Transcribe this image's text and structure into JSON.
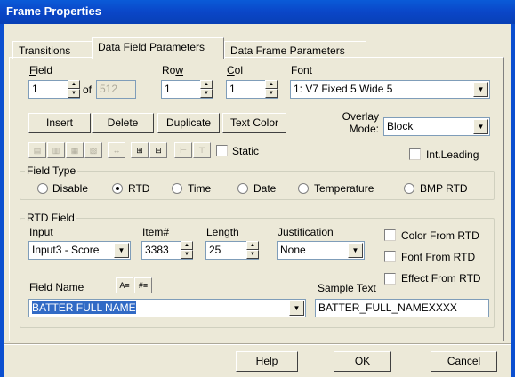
{
  "window": {
    "title": "Frame Properties"
  },
  "tabs": [
    {
      "label": "Transitions"
    },
    {
      "label": "Data Field Parameters"
    },
    {
      "label": "Data Frame Parameters"
    }
  ],
  "field": {
    "label": "Field",
    "value": "1",
    "of_label": "of",
    "total": "512"
  },
  "row": {
    "label": "Row",
    "value": "1"
  },
  "col": {
    "label": "Col",
    "value": "1"
  },
  "font": {
    "label": "Font",
    "value": "1: V7 Fixed  5 Wide  5"
  },
  "buttons": {
    "insert": "Insert",
    "delete": "Delete",
    "duplicate": "Duplicate",
    "text_color": "Text Color"
  },
  "overlay": {
    "label_line1": "Overlay",
    "label_line2": "Mode:",
    "value": "Block"
  },
  "options": {
    "static": "Static",
    "int_leading": "Int.Leading"
  },
  "field_type": {
    "title": "Field Type",
    "options": [
      "Disable",
      "RTD",
      "Time",
      "Date",
      "Temperature",
      "BMP RTD"
    ],
    "selected": "RTD"
  },
  "rtd": {
    "title": "RTD Field",
    "input_label": "Input",
    "input_value": "Input3 - Score",
    "item_label": "Item#",
    "item_value": "3383",
    "length_label": "Length",
    "length_value": "25",
    "justification_label": "Justification",
    "justification_value": "None",
    "color_from_rtd": "Color From RTD",
    "font_from_rtd": "Font From RTD",
    "effect_from_rtd": "Effect From RTD",
    "field_name_label": "Field Name",
    "field_name_value": "BATTER FULL NAME",
    "sample_text_label": "Sample Text",
    "sample_text_value": "BATTER_FULL_NAMEXXXX"
  },
  "footer": {
    "help": "Help",
    "ok": "OK",
    "cancel": "Cancel"
  }
}
